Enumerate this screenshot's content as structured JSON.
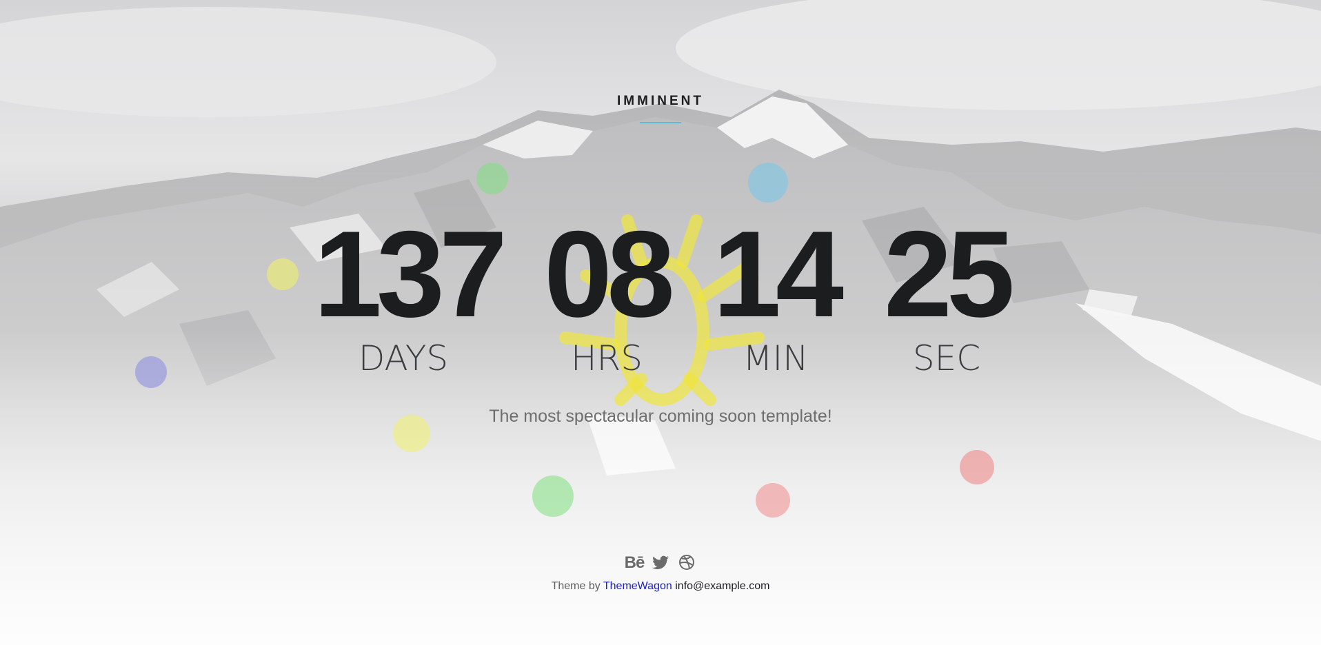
{
  "brand": {
    "name": "IMMINENT",
    "accent_color": "#5fb8d6"
  },
  "countdown": [
    {
      "value": "137",
      "label": "DAYS"
    },
    {
      "value": "08",
      "label": "HRS"
    },
    {
      "value": "14",
      "label": "MIN"
    },
    {
      "value": "25",
      "label": "SEC"
    }
  ],
  "tagline": "The most spectacular coming soon template!",
  "social": [
    {
      "icon": "behance-icon",
      "glyph": "Bē"
    },
    {
      "icon": "twitter-icon"
    },
    {
      "icon": "dribbble-icon"
    }
  ],
  "footer": {
    "prefix": "Theme by",
    "link_text": "ThemeWagon",
    "email": "info@example.com",
    "link_color": "#1a21c9"
  },
  "colors": {
    "text_dark": "#1b1d1f",
    "bubble_green": "#7fe07f",
    "bubble_blue": "#7cc6e6",
    "bubble_yellow": "#f0f06a",
    "bubble_purple": "#8f8fe0",
    "bubble_red": "#f08a8a"
  }
}
